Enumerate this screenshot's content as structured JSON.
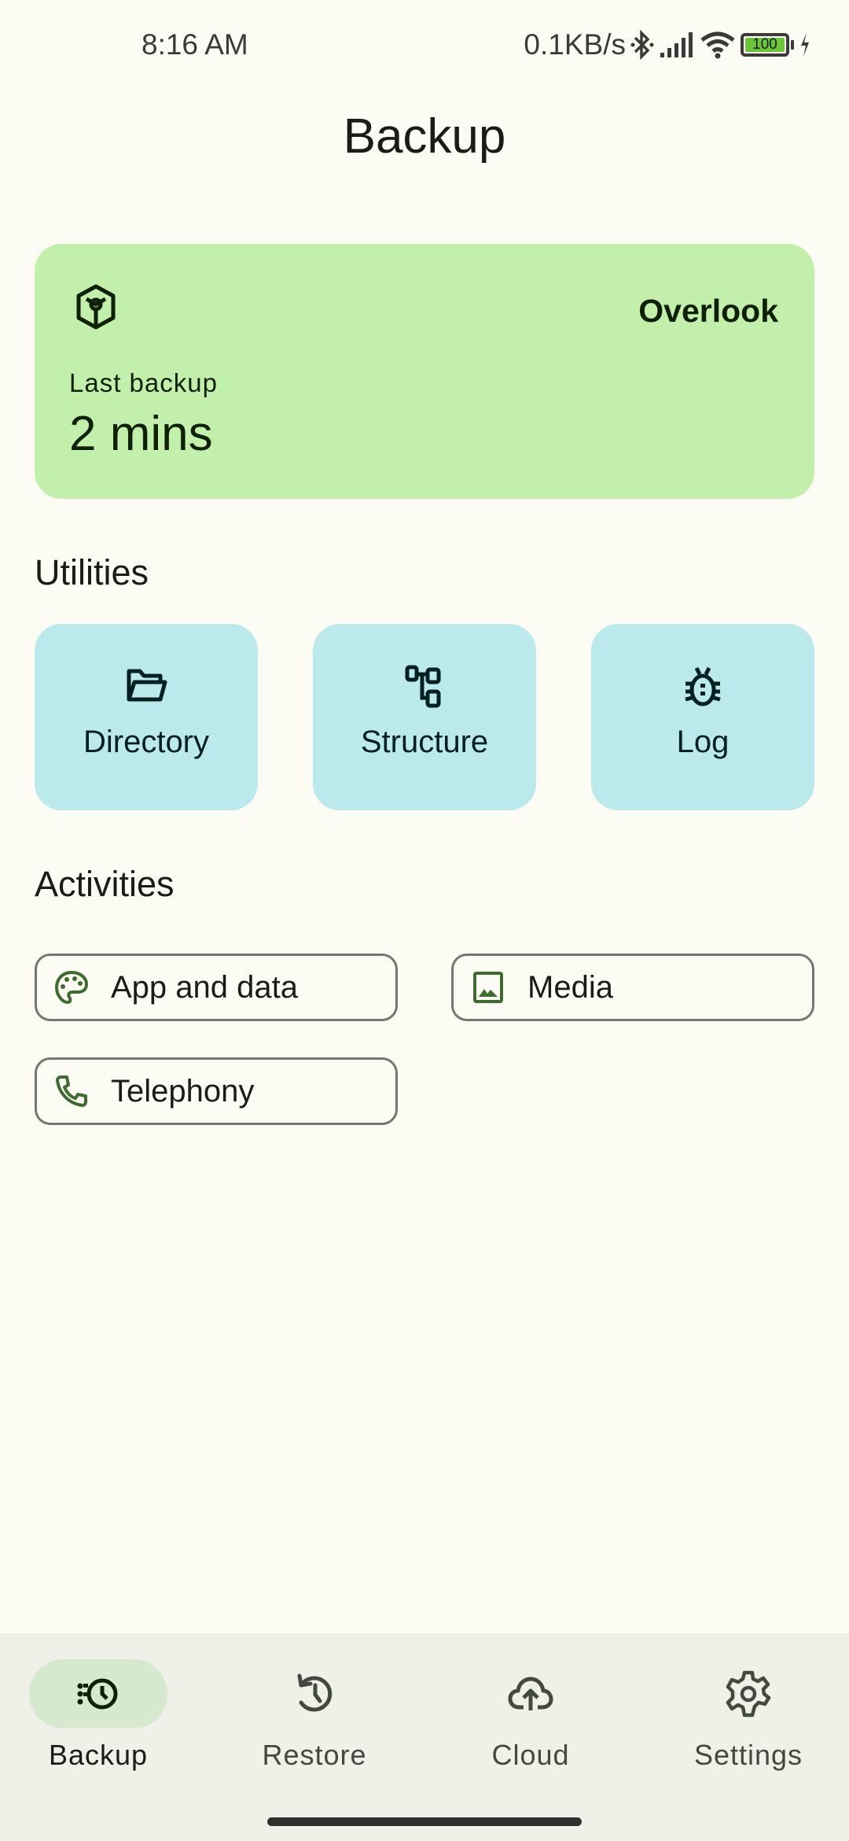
{
  "status_bar": {
    "time": "8:16 AM",
    "network_speed": "0.1KB/s",
    "battery_level": "100",
    "icons": [
      "bluetooth-icon",
      "signal-icon",
      "wifi-icon",
      "battery-icon",
      "charging-icon"
    ]
  },
  "header": {
    "title": "Backup"
  },
  "overview_card": {
    "icon": "package-icon",
    "action_label": "Overlook",
    "label": "Last backup",
    "value": "2 mins",
    "color": "#c3efad"
  },
  "utilities": {
    "title": "Utilities",
    "items": [
      {
        "label": "Directory",
        "icon": "folder-open-icon"
      },
      {
        "label": "Structure",
        "icon": "tree-structure-icon"
      },
      {
        "label": "Log",
        "icon": "bug-icon"
      }
    ],
    "color": "#bceaec"
  },
  "activities": {
    "title": "Activities",
    "items": [
      {
        "label": "App and data",
        "icon": "palette-icon"
      },
      {
        "label": "Media",
        "icon": "image-icon"
      },
      {
        "label": "Telephony",
        "icon": "phone-icon"
      }
    ],
    "icon_color": "#3e6b2f"
  },
  "bottom_nav": {
    "items": [
      {
        "label": "Backup",
        "icon": "backup-clock-icon",
        "active": true
      },
      {
        "label": "Restore",
        "icon": "history-icon",
        "active": false
      },
      {
        "label": "Cloud",
        "icon": "cloud-upload-icon",
        "active": false
      },
      {
        "label": "Settings",
        "icon": "gear-icon",
        "active": false
      }
    ]
  }
}
